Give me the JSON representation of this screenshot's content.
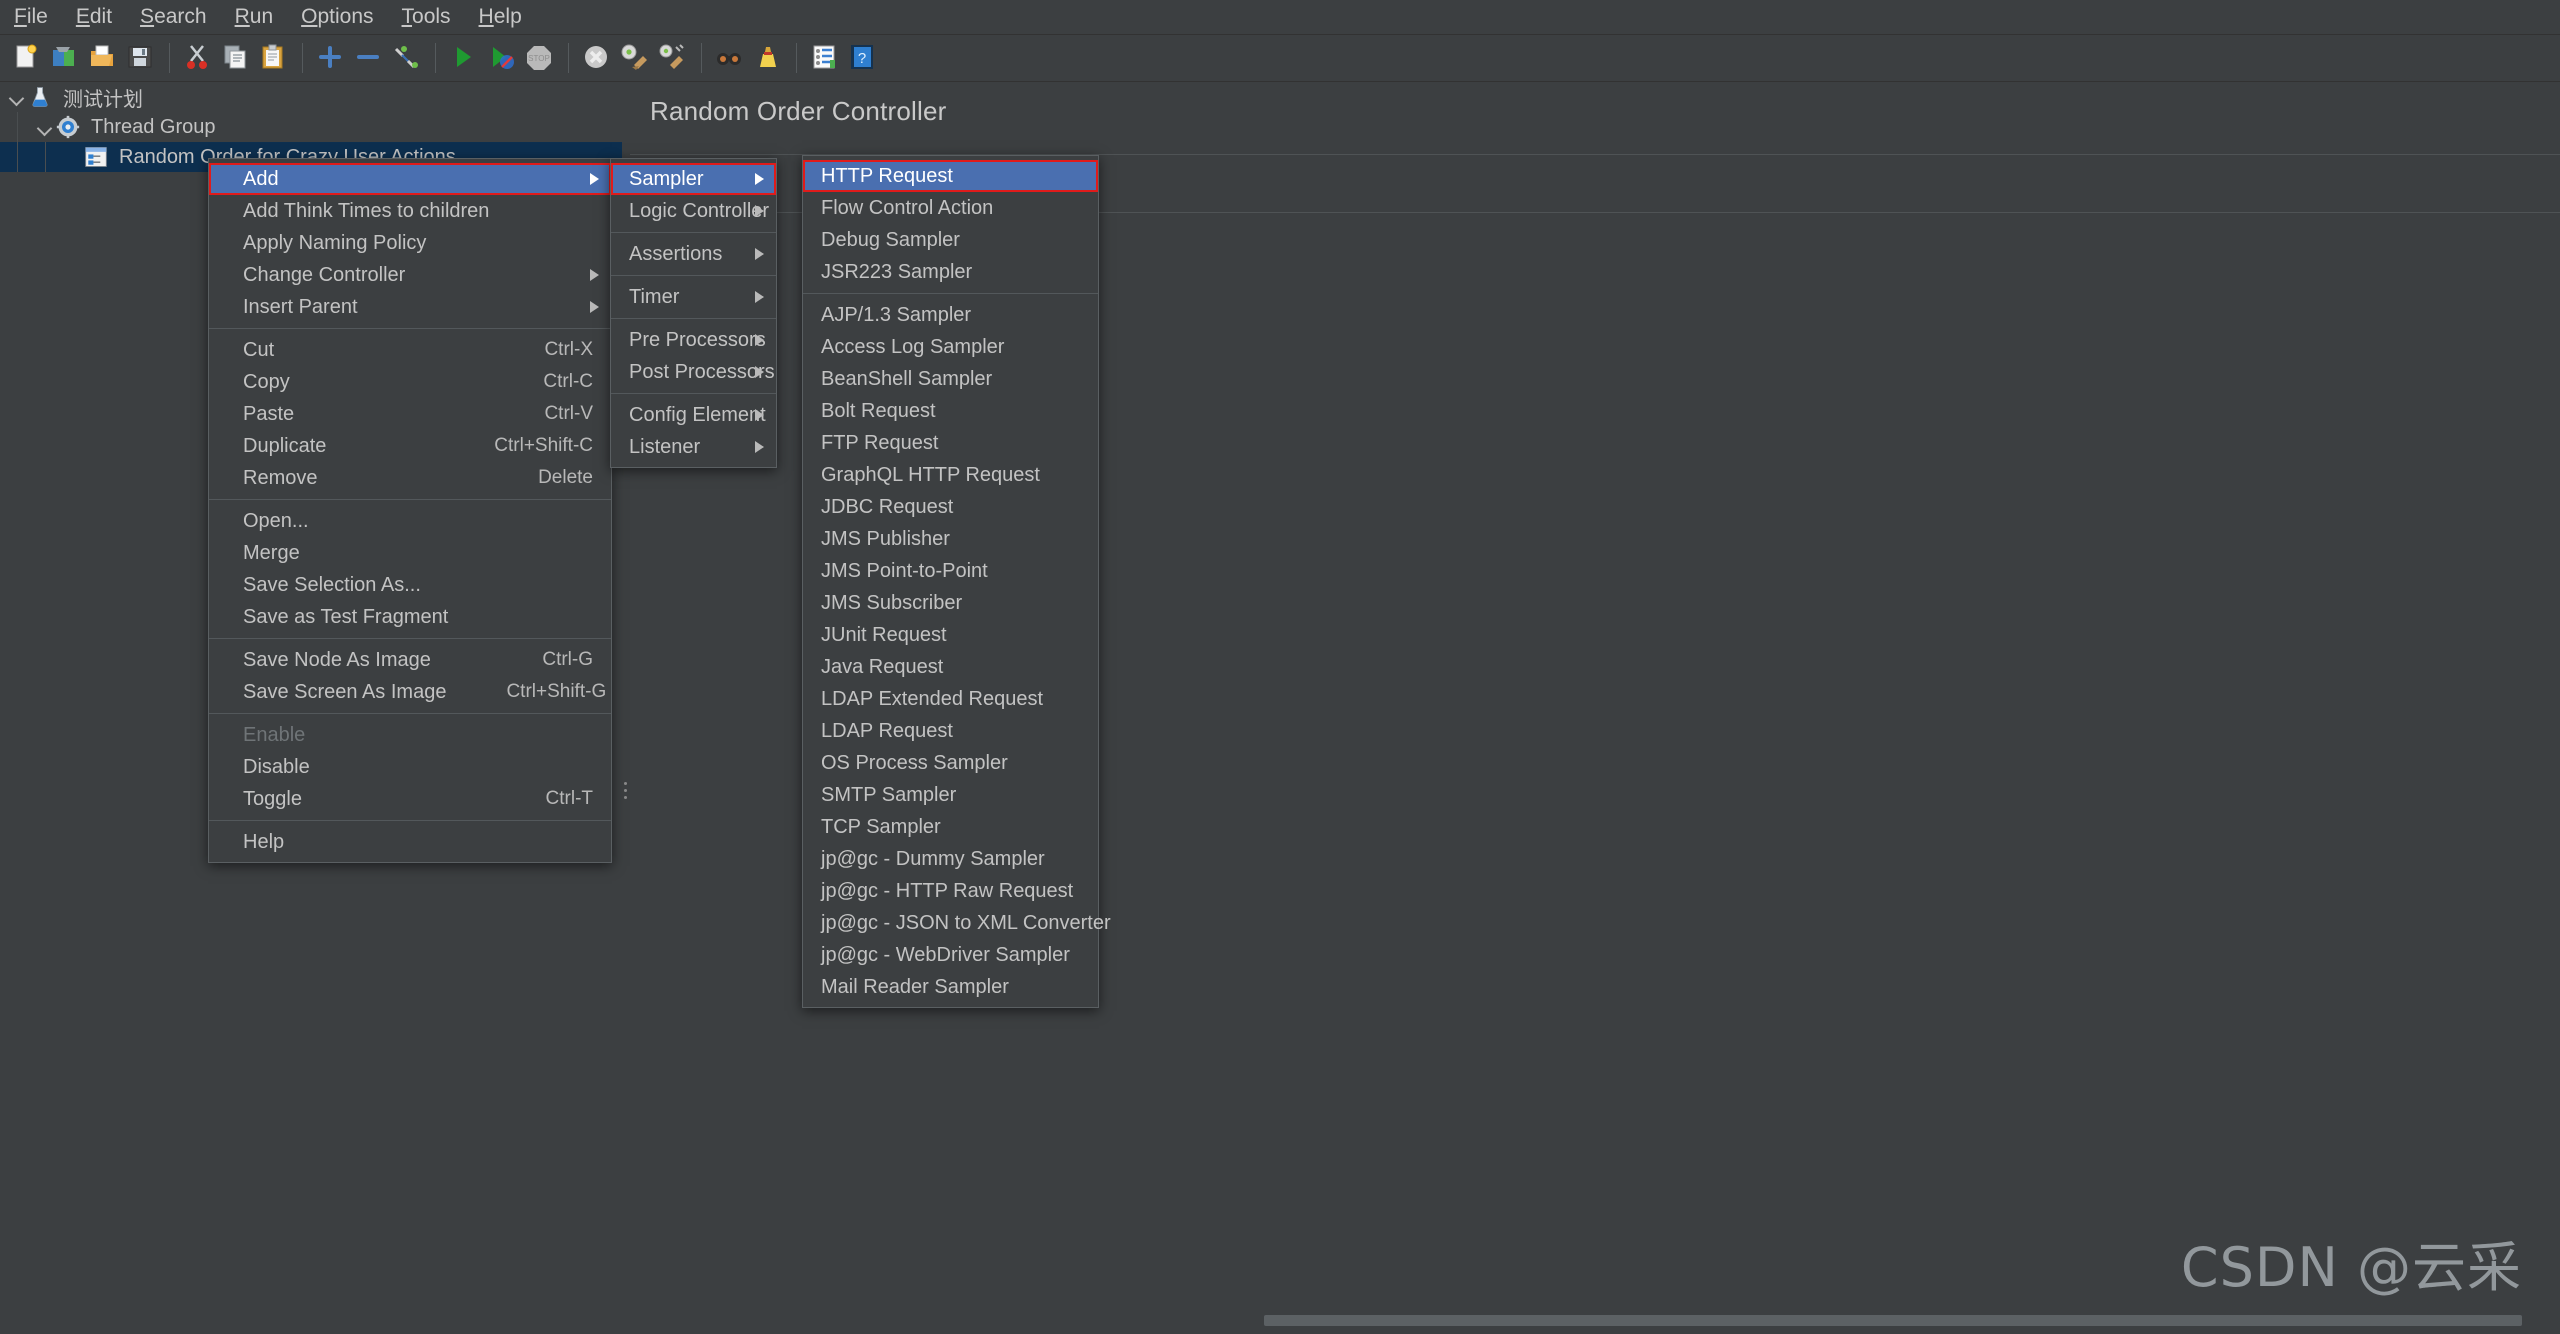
{
  "menubar": {
    "items": [
      {
        "label": "File",
        "mnemonic": "F"
      },
      {
        "label": "Edit",
        "mnemonic": "E"
      },
      {
        "label": "Search",
        "mnemonic": "S"
      },
      {
        "label": "Run",
        "mnemonic": "R"
      },
      {
        "label": "Options",
        "mnemonic": "O"
      },
      {
        "label": "Tools",
        "mnemonic": "T"
      },
      {
        "label": "Help",
        "mnemonic": "H"
      }
    ]
  },
  "toolbar": {
    "buttons": [
      {
        "name": "new-icon",
        "title": "New"
      },
      {
        "name": "templates-icon",
        "title": "Templates"
      },
      {
        "name": "open-icon",
        "title": "Open"
      },
      {
        "name": "save-icon",
        "title": "Save Test Plan"
      },
      {
        "name": "cut-icon",
        "title": "Cut"
      },
      {
        "name": "copy-icon",
        "title": "Copy"
      },
      {
        "name": "paste-icon",
        "title": "Paste"
      },
      {
        "name": "expand-all-icon",
        "title": "Expand All"
      },
      {
        "name": "collapse-all-icon",
        "title": "Collapse All"
      },
      {
        "name": "toggle-icon",
        "title": "Toggle"
      },
      {
        "name": "start-icon",
        "title": "Start"
      },
      {
        "name": "start-no-pauses-icon",
        "title": "Start no pauses"
      },
      {
        "name": "stop-icon",
        "title": "Stop"
      },
      {
        "name": "shutdown-icon",
        "title": "Shutdown"
      },
      {
        "name": "clear-icon",
        "title": "Clear"
      },
      {
        "name": "clear-all-icon",
        "title": "Clear All"
      },
      {
        "name": "search-icon",
        "title": "Search"
      },
      {
        "name": "reset-search-icon",
        "title": "Reset Search"
      },
      {
        "name": "function-helper-icon",
        "title": "Function Helper Dialog"
      },
      {
        "name": "help-icon",
        "title": "Help"
      }
    ]
  },
  "tree": {
    "nodes": [
      {
        "label": "测试计划",
        "icon": "test-plan-icon",
        "depth": 0,
        "expanded": true,
        "selected": false
      },
      {
        "label": "Thread Group",
        "icon": "thread-group-icon",
        "depth": 1,
        "expanded": true,
        "selected": false
      },
      {
        "label": "Random Order for Crazy User Actions",
        "icon": "controller-icon",
        "depth": 2,
        "expanded": false,
        "selected": true
      }
    ]
  },
  "right_panel": {
    "title": "Random Order Controller"
  },
  "context_menu": {
    "groups": [
      [
        {
          "label": "Add",
          "accel": "",
          "submenu": true,
          "highlighted": true,
          "annotated": true,
          "disabled": false
        },
        {
          "label": "Add Think Times to children",
          "accel": "",
          "submenu": false,
          "highlighted": false,
          "disabled": false
        },
        {
          "label": "Apply Naming Policy",
          "accel": "",
          "submenu": false,
          "highlighted": false,
          "disabled": false
        },
        {
          "label": "Change Controller",
          "accel": "",
          "submenu": true,
          "highlighted": false,
          "disabled": false
        },
        {
          "label": "Insert Parent",
          "accel": "",
          "submenu": true,
          "highlighted": false,
          "disabled": false
        }
      ],
      [
        {
          "label": "Cut",
          "accel": "Ctrl-X",
          "submenu": false,
          "highlighted": false,
          "disabled": false
        },
        {
          "label": "Copy",
          "accel": "Ctrl-C",
          "submenu": false,
          "highlighted": false,
          "disabled": false
        },
        {
          "label": "Paste",
          "accel": "Ctrl-V",
          "submenu": false,
          "highlighted": false,
          "disabled": false
        },
        {
          "label": "Duplicate",
          "accel": "Ctrl+Shift-C",
          "submenu": false,
          "highlighted": false,
          "disabled": false
        },
        {
          "label": "Remove",
          "accel": "Delete",
          "submenu": false,
          "highlighted": false,
          "disabled": false
        }
      ],
      [
        {
          "label": "Open...",
          "accel": "",
          "submenu": false,
          "highlighted": false,
          "disabled": false
        },
        {
          "label": "Merge",
          "accel": "",
          "submenu": false,
          "highlighted": false,
          "disabled": false
        },
        {
          "label": "Save Selection As...",
          "accel": "",
          "submenu": false,
          "highlighted": false,
          "disabled": false
        },
        {
          "label": "Save as Test Fragment",
          "accel": "",
          "submenu": false,
          "highlighted": false,
          "disabled": false
        }
      ],
      [
        {
          "label": "Save Node As Image",
          "accel": "Ctrl-G",
          "submenu": false,
          "highlighted": false,
          "disabled": false
        },
        {
          "label": "Save Screen As Image",
          "accel": "Ctrl+Shift-G",
          "submenu": false,
          "highlighted": false,
          "disabled": false
        }
      ],
      [
        {
          "label": "Enable",
          "accel": "",
          "submenu": false,
          "highlighted": false,
          "disabled": true
        },
        {
          "label": "Disable",
          "accel": "",
          "submenu": false,
          "highlighted": false,
          "disabled": false
        },
        {
          "label": "Toggle",
          "accel": "Ctrl-T",
          "submenu": false,
          "highlighted": false,
          "disabled": false
        }
      ],
      [
        {
          "label": "Help",
          "accel": "",
          "submenu": false,
          "highlighted": false,
          "disabled": false
        }
      ]
    ]
  },
  "add_submenu": {
    "groups": [
      [
        {
          "label": "Sampler",
          "submenu": true,
          "highlighted": true,
          "annotated": true
        },
        {
          "label": "Logic Controller",
          "submenu": true,
          "highlighted": false,
          "annotated": false
        }
      ],
      [
        {
          "label": "Assertions",
          "submenu": true,
          "highlighted": false,
          "annotated": false
        }
      ],
      [
        {
          "label": "Timer",
          "submenu": true,
          "highlighted": false,
          "annotated": false
        }
      ],
      [
        {
          "label": "Pre Processors",
          "submenu": true,
          "highlighted": false,
          "annotated": false
        },
        {
          "label": "Post Processors",
          "submenu": true,
          "highlighted": false,
          "annotated": false
        }
      ],
      [
        {
          "label": "Config Element",
          "submenu": true,
          "highlighted": false,
          "annotated": false
        },
        {
          "label": "Listener",
          "submenu": true,
          "highlighted": false,
          "annotated": false
        }
      ]
    ]
  },
  "sampler_submenu": {
    "groups": [
      [
        {
          "label": "HTTP Request",
          "highlighted": true,
          "annotated": true
        },
        {
          "label": "Flow Control Action",
          "highlighted": false,
          "annotated": false
        },
        {
          "label": "Debug Sampler",
          "highlighted": false,
          "annotated": false
        },
        {
          "label": "JSR223 Sampler",
          "highlighted": false,
          "annotated": false
        }
      ],
      [
        {
          "label": "AJP/1.3 Sampler",
          "highlighted": false,
          "annotated": false
        },
        {
          "label": "Access Log Sampler",
          "highlighted": false,
          "annotated": false
        },
        {
          "label": "BeanShell Sampler",
          "highlighted": false,
          "annotated": false
        },
        {
          "label": "Bolt Request",
          "highlighted": false,
          "annotated": false
        },
        {
          "label": "FTP Request",
          "highlighted": false,
          "annotated": false
        },
        {
          "label": "GraphQL HTTP Request",
          "highlighted": false,
          "annotated": false
        },
        {
          "label": "JDBC Request",
          "highlighted": false,
          "annotated": false
        },
        {
          "label": "JMS Publisher",
          "highlighted": false,
          "annotated": false
        },
        {
          "label": "JMS Point-to-Point",
          "highlighted": false,
          "annotated": false
        },
        {
          "label": "JMS Subscriber",
          "highlighted": false,
          "annotated": false
        },
        {
          "label": "JUnit Request",
          "highlighted": false,
          "annotated": false
        },
        {
          "label": "Java Request",
          "highlighted": false,
          "annotated": false
        },
        {
          "label": "LDAP Extended Request",
          "highlighted": false,
          "annotated": false
        },
        {
          "label": "LDAP Request",
          "highlighted": false,
          "annotated": false
        },
        {
          "label": "OS Process Sampler",
          "highlighted": false,
          "annotated": false
        },
        {
          "label": "SMTP Sampler",
          "highlighted": false,
          "annotated": false
        },
        {
          "label": "TCP Sampler",
          "highlighted": false,
          "annotated": false
        },
        {
          "label": "jp@gc - Dummy Sampler",
          "highlighted": false,
          "annotated": false
        },
        {
          "label": "jp@gc - HTTP Raw Request",
          "highlighted": false,
          "annotated": false
        },
        {
          "label": "jp@gc - JSON to XML Converter",
          "highlighted": false,
          "annotated": false
        },
        {
          "label": "jp@gc - WebDriver Sampler",
          "highlighted": false,
          "annotated": false
        },
        {
          "label": "Mail Reader Sampler",
          "highlighted": false,
          "annotated": false
        }
      ]
    ]
  },
  "watermark": {
    "text": "CSDN @云采"
  },
  "colors": {
    "background": "#3c3f41",
    "menu_highlight": "#4a6fb0",
    "annotation": "#e01b1b",
    "tree_selection": "#0d2f4f",
    "text": "#c3c3c3"
  }
}
